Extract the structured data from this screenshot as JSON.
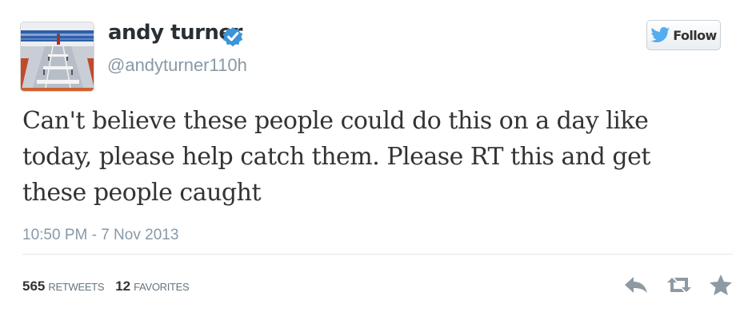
{
  "user": {
    "name": "andy turner",
    "handle": "@andyturner110h",
    "verified_color": "#3b94d9"
  },
  "follow_button": {
    "label": "Follow",
    "icon": "twitter-bird-icon",
    "icon_color": "#55acee"
  },
  "tweet": {
    "text": "Can't believe these people could do this on a day like\ntoday, please help catch them. Please RT this and get\nthese people caught",
    "timestamp": "10:50 PM - 7 Nov 2013"
  },
  "stats": {
    "retweets_count": "565",
    "retweets_label": "RETWEETS",
    "favorites_count": "12",
    "favorites_label": "FAVORITES"
  },
  "actions": [
    {
      "name": "reply-icon"
    },
    {
      "name": "retweet-icon"
    },
    {
      "name": "favorite-icon"
    }
  ],
  "colors": {
    "action_icon": "#8e9aa3",
    "divider": "#e1e8ed",
    "muted_text": "#8899a6"
  }
}
